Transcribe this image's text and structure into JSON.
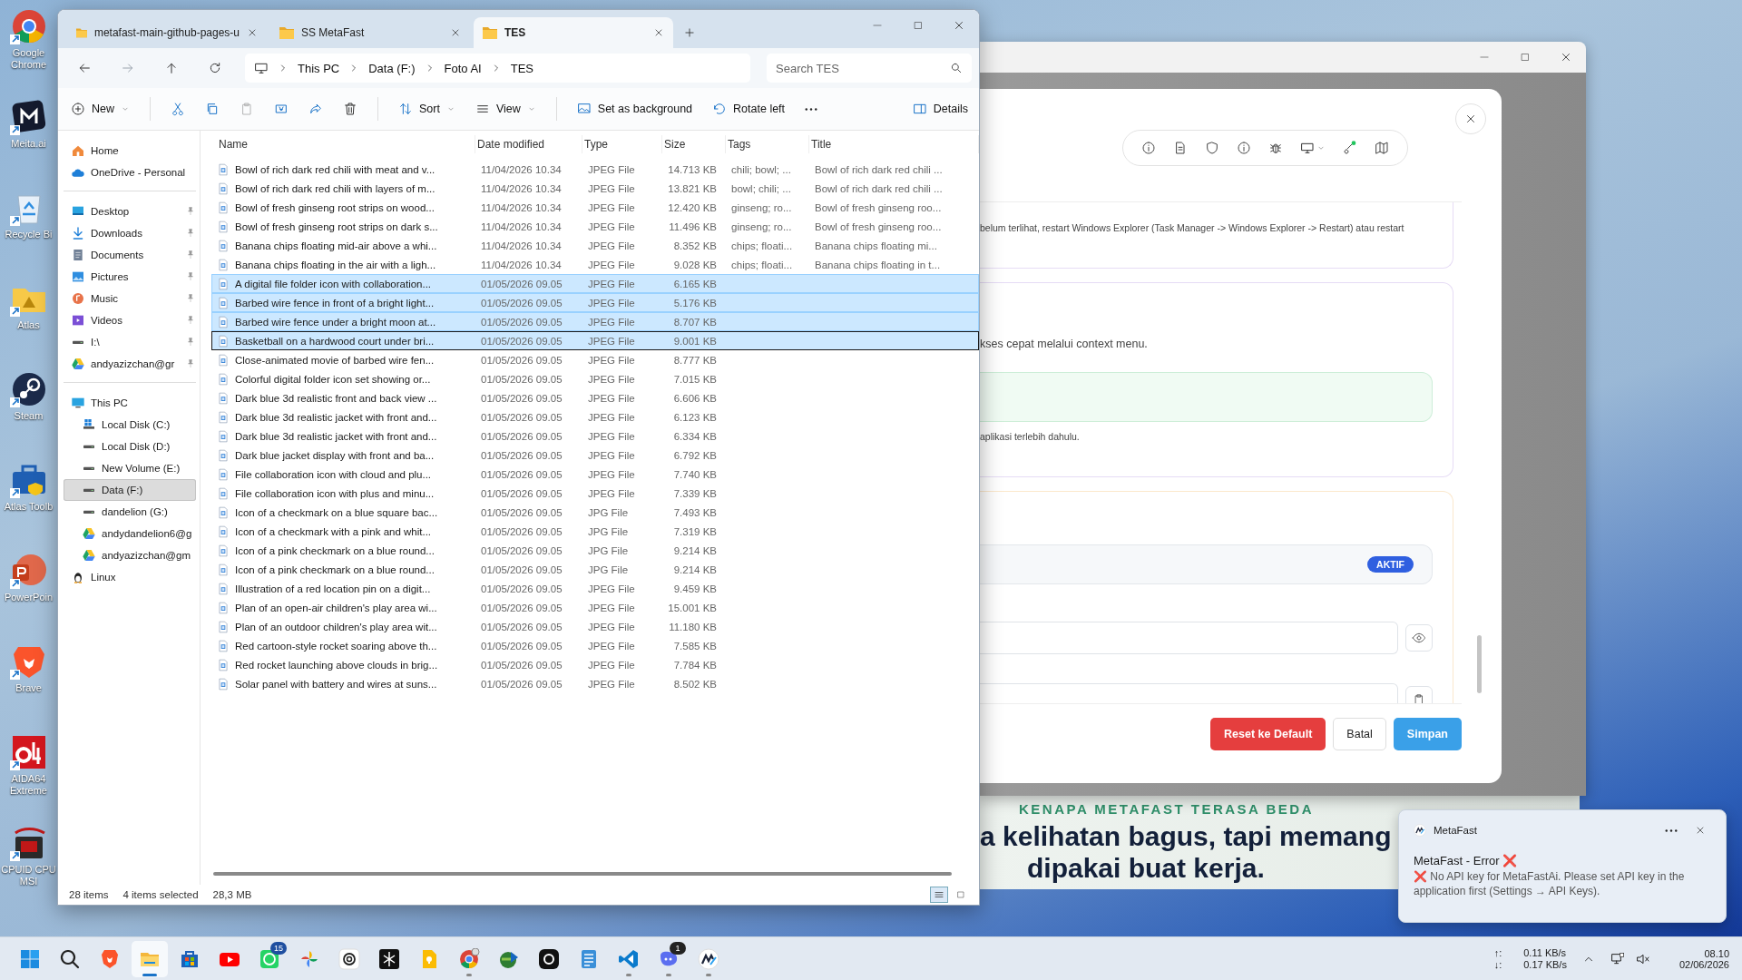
{
  "desktop_icons": [
    {
      "label": "Google Chrome",
      "kind": "chrome"
    },
    {
      "label": "Meita.ai",
      "kind": "meita"
    },
    {
      "label": "Recycle Bi",
      "kind": "recycle"
    },
    {
      "label": "Atlas",
      "kind": "atlas"
    },
    {
      "label": "Steam",
      "kind": "steam"
    },
    {
      "label": "Atlas Toolb",
      "kind": "toolbox"
    },
    {
      "label": "PowerPoin",
      "kind": "powerpoint"
    },
    {
      "label": "Brave",
      "kind": "brave"
    },
    {
      "label": "AIDA64 Extreme",
      "kind": "aida"
    },
    {
      "label": "CPUID CPU MSI",
      "kind": "cpuid"
    }
  ],
  "explorer": {
    "tabs": [
      {
        "label": "metafast-main-github-pages-u",
        "selected": false
      },
      {
        "label": "SS MetaFast",
        "selected": false
      },
      {
        "label": "TES",
        "selected": true
      }
    ],
    "nav_buttons": [
      {
        "kind": "back",
        "disabled": false
      },
      {
        "kind": "forward",
        "disabled": true
      },
      {
        "kind": "up",
        "disabled": false
      },
      {
        "kind": "refresh",
        "disabled": false
      }
    ],
    "breadcrumb": [
      "This PC",
      "Data (F:)",
      "Foto AI",
      "TES"
    ],
    "search": {
      "placeholder": "Search TES"
    },
    "toolbar": [
      {
        "kind": "new",
        "label": "New",
        "disabled": false
      },
      {
        "kind": "cut",
        "disabled": false
      },
      {
        "kind": "copy",
        "disabled": false
      },
      {
        "kind": "paste",
        "disabled": true
      },
      {
        "kind": "rename",
        "disabled": false
      },
      {
        "kind": "share",
        "disabled": false
      },
      {
        "kind": "delete",
        "disabled": false
      },
      {
        "kind": "sort",
        "label": "Sort",
        "disabled": false
      },
      {
        "kind": "view",
        "label": "View",
        "disabled": false
      },
      {
        "kind": "background",
        "label": "Set as background",
        "disabled": false
      },
      {
        "kind": "rotate",
        "label": "Rotate left",
        "disabled": false
      },
      {
        "kind": "more",
        "disabled": false
      }
    ],
    "details_button": "Details",
    "nav_sections": [
      {
        "items": [
          {
            "label": "Home",
            "kind": "home",
            "pinned": false,
            "selected": false
          },
          {
            "label": "OneDrive - Personal",
            "kind": "cloud",
            "pinned": false,
            "selected": false
          }
        ]
      },
      {
        "items": [
          {
            "label": "Desktop",
            "kind": "desktop",
            "pinned": true,
            "selected": false
          },
          {
            "label": "Downloads",
            "kind": "downloads",
            "pinned": true,
            "selected": false
          },
          {
            "label": "Documents",
            "kind": "documents",
            "pinned": true,
            "selected": false
          },
          {
            "label": "Pictures",
            "kind": "pictures",
            "pinned": true,
            "selected": false
          },
          {
            "label": "Music",
            "kind": "music",
            "pinned": true,
            "selected": false
          },
          {
            "label": "Videos",
            "kind": "videos",
            "pinned": true,
            "selected": false
          },
          {
            "label": "I:\\",
            "kind": "drive",
            "pinned": true,
            "selected": false
          },
          {
            "label": "andyazizchan@gr",
            "kind": "gdrive",
            "pinned": true,
            "selected": false
          }
        ]
      },
      {
        "items": [
          {
            "label": "This PC",
            "kind": "pc",
            "pinned": false,
            "selected": false,
            "children": [
              {
                "label": "Local Disk (C:)",
                "kind": "windrive",
                "selected": false
              },
              {
                "label": "Local Disk (D:)",
                "kind": "drive",
                "selected": false
              },
              {
                "label": "New Volume (E:)",
                "kind": "drive",
                "selected": false
              },
              {
                "label": "Data (F:)",
                "kind": "drive",
                "selected": true
              },
              {
                "label": "dandelion (G:)",
                "kind": "drive",
                "selected": false
              },
              {
                "label": "andydandelion6@g",
                "kind": "gdrive",
                "selected": false
              },
              {
                "label": "andyazizchan@gm",
                "kind": "gdrive",
                "selected": false
              }
            ]
          },
          {
            "label": "Linux",
            "kind": "linux",
            "pinned": false,
            "selected": false
          }
        ]
      }
    ],
    "columns": [
      "Name",
      "Date modified",
      "Type",
      "Size",
      "Tags",
      "Title"
    ],
    "rows": [
      {
        "name": "Bowl of rich dark red chili with meat and v...",
        "date": "11/04/2026 10.34",
        "type": "JPEG File",
        "size": "14.713 KB",
        "tags": "chili; bowl; ...",
        "title": "Bowl of rich dark red chili ...",
        "selected": false,
        "focused": false
      },
      {
        "name": "Bowl of rich dark red chili with layers of m...",
        "date": "11/04/2026 10.34",
        "type": "JPEG File",
        "size": "13.821 KB",
        "tags": "bowl; chili; ...",
        "title": "Bowl of rich dark red chili ...",
        "selected": false,
        "focused": false
      },
      {
        "name": "Bowl of fresh ginseng root strips on wood...",
        "date": "11/04/2026 10.34",
        "type": "JPEG File",
        "size": "12.420 KB",
        "tags": "ginseng; ro...",
        "title": "Bowl of fresh ginseng roo...",
        "selected": false,
        "focused": false
      },
      {
        "name": "Bowl of fresh ginseng root strips on dark s...",
        "date": "11/04/2026 10.34",
        "type": "JPEG File",
        "size": "11.496 KB",
        "tags": "ginseng; ro...",
        "title": "Bowl of fresh ginseng roo...",
        "selected": false,
        "focused": false
      },
      {
        "name": "Banana chips floating mid-air above a whi...",
        "date": "11/04/2026 10.34",
        "type": "JPEG File",
        "size": "8.352 KB",
        "tags": "chips; floati...",
        "title": "Banana chips floating mi...",
        "selected": false,
        "focused": false
      },
      {
        "name": "Banana chips floating in the air with a ligh...",
        "date": "11/04/2026 10.34",
        "type": "JPEG File",
        "size": "9.028 KB",
        "tags": "chips; floati...",
        "title": "Banana chips floating in t...",
        "selected": false,
        "focused": false
      },
      {
        "name": "A digital file folder icon with collaboration...",
        "date": "01/05/2026 09.05",
        "type": "JPEG File",
        "size": "6.165 KB",
        "selected": true,
        "focused": false
      },
      {
        "name": "Barbed wire fence in front of a bright light...",
        "date": "01/05/2026 09.05",
        "type": "JPEG File",
        "size": "5.176 KB",
        "selected": true,
        "focused": false
      },
      {
        "name": "Barbed wire fence under a bright moon at...",
        "date": "01/05/2026 09.05",
        "type": "JPEG File",
        "size": "8.707 KB",
        "selected": true,
        "focused": false
      },
      {
        "name": "Basketball on a hardwood court under bri...",
        "date": "01/05/2026 09.05",
        "type": "JPEG File",
        "size": "9.001 KB",
        "selected": true,
        "focused": true
      },
      {
        "name": "Close-animated movie of barbed wire fen...",
        "date": "01/05/2026 09.05",
        "type": "JPEG File",
        "size": "8.777 KB",
        "selected": false,
        "focused": false
      },
      {
        "name": "Colorful digital folder icon set showing or...",
        "date": "01/05/2026 09.05",
        "type": "JPEG File",
        "size": "7.015 KB",
        "selected": false,
        "focused": false
      },
      {
        "name": "Dark blue 3d realistic front and back view ...",
        "date": "01/05/2026 09.05",
        "type": "JPEG File",
        "size": "6.606 KB",
        "selected": false,
        "focused": false
      },
      {
        "name": "Dark blue 3d realistic jacket with front and...",
        "date": "01/05/2026 09.05",
        "type": "JPEG File",
        "size": "6.123 KB",
        "selected": false,
        "focused": false
      },
      {
        "name": "Dark blue 3d realistic jacket with front and...",
        "date": "01/05/2026 09.05",
        "type": "JPEG File",
        "size": "6.334 KB",
        "selected": false,
        "focused": false
      },
      {
        "name": "Dark blue jacket display with front and ba...",
        "date": "01/05/2026 09.05",
        "type": "JPEG File",
        "size": "6.792 KB",
        "selected": false,
        "focused": false
      },
      {
        "name": "File collaboration icon with cloud and plu...",
        "date": "01/05/2026 09.05",
        "type": "JPEG File",
        "size": "7.740 KB",
        "selected": false,
        "focused": false
      },
      {
        "name": "File collaboration icon with plus and minu...",
        "date": "01/05/2026 09.05",
        "type": "JPEG File",
        "size": "7.339 KB",
        "selected": false,
        "focused": false
      },
      {
        "name": "Icon of a checkmark on a blue square bac...",
        "date": "01/05/2026 09.05",
        "type": "JPG File",
        "size": "7.493 KB",
        "selected": false,
        "focused": false
      },
      {
        "name": "Icon of a checkmark with a pink and whit...",
        "date": "01/05/2026 09.05",
        "type": "JPG File",
        "size": "7.319 KB",
        "selected": false,
        "focused": false
      },
      {
        "name": "Icon of a pink checkmark on a blue round...",
        "date": "01/05/2026 09.05",
        "type": "JPG File",
        "size": "9.214 KB",
        "selected": false,
        "focused": false
      },
      {
        "name": "Icon of a pink checkmark on a blue round...",
        "date": "01/05/2026 09.05",
        "type": "JPG File",
        "size": "9.214 KB",
        "selected": false,
        "focused": false
      },
      {
        "name": "Illustration of a red location pin on a digit...",
        "date": "01/05/2026 09.05",
        "type": "JPEG File",
        "size": "9.459 KB",
        "selected": false,
        "focused": false
      },
      {
        "name": "Plan of an open-air children's play area wi...",
        "date": "01/05/2026 09.05",
        "type": "JPEG File",
        "size": "15.001 KB",
        "selected": false,
        "focused": false
      },
      {
        "name": "Plan of an outdoor children's play area wit...",
        "date": "01/05/2026 09.05",
        "type": "JPEG File",
        "size": "11.180 KB",
        "selected": false,
        "focused": false
      },
      {
        "name": "Red cartoon-style rocket soaring above th...",
        "date": "01/05/2026 09.05",
        "type": "JPEG File",
        "size": "7.585 KB",
        "selected": false,
        "focused": false
      },
      {
        "name": "Red rocket launching above clouds in brig...",
        "date": "01/05/2026 09.05",
        "type": "JPEG File",
        "size": "7.784 KB",
        "selected": false,
        "focused": false
      },
      {
        "name": "Solar panel with battery and wires at suns...",
        "date": "01/05/2026 09.05",
        "type": "JPEG File",
        "size": "8.502 KB",
        "selected": false,
        "focused": false
      }
    ],
    "status": {
      "count": "28 items",
      "selection": "4 items selected",
      "size": "28,3 MB"
    }
  },
  "settings_dialog": {
    "toolbar_icons": [
      {
        "kind": "info"
      },
      {
        "kind": "document"
      },
      {
        "kind": "shield"
      },
      {
        "kind": "info"
      },
      {
        "kind": "bug"
      },
      {
        "kind": "monitor"
      },
      {
        "kind": "key"
      },
      {
        "kind": "map"
      }
    ],
    "notes": [
      "belum terlihat, restart Windows Explorer (Task Manager -> Windows Explorer -> Restart) atau restart",
      "kses cepat melalui context menu.",
      "aplikasi terlebih dahulu."
    ],
    "badge": "AKTIF",
    "buttons": [
      {
        "label": "Reset ke Default",
        "kind": "danger"
      },
      {
        "label": "Batal",
        "kind": "secondary"
      },
      {
        "label": "Simpan",
        "kind": "primary"
      }
    ]
  },
  "webpage": {
    "eyebrow": "KENAPA METAFAST TERASA BEDA",
    "headline": [
      "a kelihatan bagus, tapi memang",
      "dipakai buat kerja."
    ]
  },
  "notification": {
    "app": "MetaFast",
    "title": "MetaFast - Error ❌",
    "body": "❌ No API key for MetaFastAi. Please set API key in the application first (Settings → API Keys)."
  },
  "taskbar": {
    "apps": [
      {
        "kind": "start",
        "running": false,
        "active": false
      },
      {
        "kind": "search",
        "running": false,
        "active": false
      },
      {
        "kind": "brave",
        "running": false,
        "active": false
      },
      {
        "kind": "explorer",
        "running": true,
        "active": true
      },
      {
        "kind": "store",
        "running": false,
        "active": false
      },
      {
        "kind": "youtube",
        "running": false,
        "active": false
      },
      {
        "kind": "whatsapp",
        "running": false,
        "active": false,
        "badge": "15"
      },
      {
        "kind": "photos",
        "running": false,
        "active": false
      },
      {
        "kind": "chatgpt",
        "running": false,
        "active": false
      },
      {
        "kind": "darkapp",
        "running": false,
        "active": false
      },
      {
        "kind": "keep",
        "running": false,
        "active": false
      },
      {
        "kind": "chrome",
        "running": true,
        "active": false
      },
      {
        "kind": "idm",
        "running": false,
        "active": false
      },
      {
        "kind": "threads",
        "running": false,
        "active": false
      },
      {
        "kind": "notepad",
        "running": false,
        "active": false
      },
      {
        "kind": "vscode",
        "running": true,
        "active": false
      },
      {
        "kind": "assistant",
        "running": true,
        "active": false,
        "badge": "1"
      },
      {
        "kind": "metafast",
        "running": true,
        "active": false
      }
    ],
    "upload_label": "↑:",
    "upload": "0.11 KB/s",
    "download_label": "↓:",
    "download": "0.17 KB/s",
    "time": "08.10",
    "date": "02/06/2026"
  }
}
